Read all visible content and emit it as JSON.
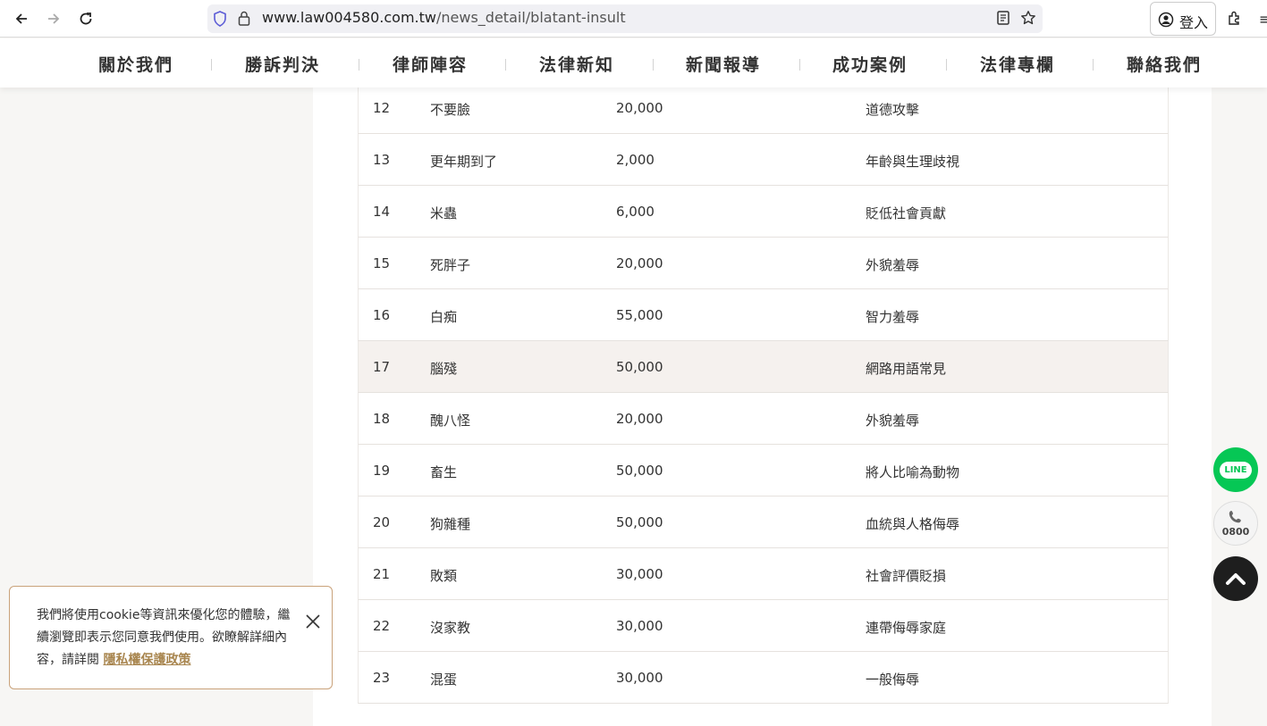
{
  "browser": {
    "url_host": "www.law004580.com.tw",
    "url_path": "/news_detail/blatant-insult",
    "login_label": "登入"
  },
  "nav": {
    "items": [
      "關於我們",
      "勝訴判決",
      "律師陣容",
      "法律新知",
      "新聞報導",
      "成功案例",
      "法律專欄",
      "聯絡我們"
    ]
  },
  "table": {
    "rows": [
      {
        "no": "12",
        "word": "不要臉",
        "amount": "20,000",
        "type": "道德攻擊"
      },
      {
        "no": "13",
        "word": "更年期到了",
        "amount": "2,000",
        "type": "年齡與生理歧視"
      },
      {
        "no": "14",
        "word": "米蟲",
        "amount": "6,000",
        "type": "貶低社會貢獻"
      },
      {
        "no": "15",
        "word": "死胖子",
        "amount": "20,000",
        "type": "外貌羞辱"
      },
      {
        "no": "16",
        "word": "白痴",
        "amount": "55,000",
        "type": "智力羞辱"
      },
      {
        "no": "17",
        "word": "腦殘",
        "amount": "50,000",
        "type": "網路用語常見"
      },
      {
        "no": "18",
        "word": "醜八怪",
        "amount": "20,000",
        "type": "外貌羞辱"
      },
      {
        "no": "19",
        "word": "畜生",
        "amount": "50,000",
        "type": "將人比喻為動物"
      },
      {
        "no": "20",
        "word": "狗雜種",
        "amount": "50,000",
        "type": "血統與人格侮辱"
      },
      {
        "no": "21",
        "word": "敗類",
        "amount": "30,000",
        "type": "社會評價貶損"
      },
      {
        "no": "22",
        "word": "沒家教",
        "amount": "30,000",
        "type": "連帶侮辱家庭"
      },
      {
        "no": "23",
        "word": "混蛋",
        "amount": "30,000",
        "type": "一般侮辱"
      }
    ],
    "highlighted_row": "17"
  },
  "floating": {
    "line_label": "LINE",
    "phone_label": "0800"
  },
  "cookie": {
    "text": "我們將使用cookie等資訊來優化您的體驗，繼續瀏覽即表示您同意我們使用。欲瞭解詳細內容，請詳閱 ",
    "link_label": "隱私權保護政策"
  },
  "colors": {
    "accent": "#c9a27a",
    "link": "#a8854e",
    "line_green": "#06c755",
    "row_highlight": "#f5f1ee"
  }
}
